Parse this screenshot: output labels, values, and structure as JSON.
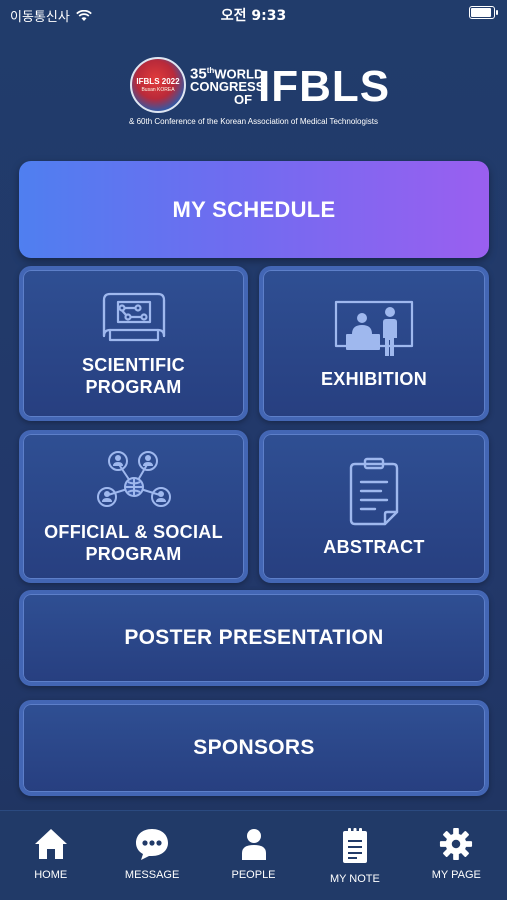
{
  "status_bar": {
    "carrier": "이동통신사",
    "time": "오전 9:33",
    "battery_level": 0.95
  },
  "header": {
    "emblem_year": "IFBLS 2022",
    "emblem_city": "Busan KOREA",
    "world_number": "35",
    "world_suffix": "th",
    "world_line1": "WORLD",
    "world_line2": "CONGRESS",
    "world_line3": "OF",
    "brand": "IFBLS",
    "subtitle": "& 60th Conference of the Korean Association of Medical Technologists"
  },
  "menu": {
    "my_schedule": "MY SCHEDULE",
    "scientific_line1": "SCIENTIFIC",
    "scientific_line2": "PROGRAM",
    "exhibition": "EXHIBITION",
    "official_line1": "OFFICIAL & SOCIAL",
    "official_line2": "PROGRAM",
    "abstract": "ABSTRACT",
    "poster": "POSTER PRESENTATION",
    "sponsors": "SPONSORS"
  },
  "tabs": {
    "home": "HOME",
    "message": "MESSAGE",
    "people": "PEOPLE",
    "my_note": "MY NOTE",
    "my_page": "MY PAGE"
  },
  "icons": {
    "home": "home-icon",
    "message": "message-icon",
    "people": "person-icon",
    "my_note": "note-icon",
    "my_page": "gear-icon"
  },
  "colors": {
    "background": "#22386a",
    "tile": "#2f4f93",
    "tile_border": "#4366b4",
    "schedule_start": "#4f7ff0",
    "schedule_end": "#9a5ff0"
  }
}
